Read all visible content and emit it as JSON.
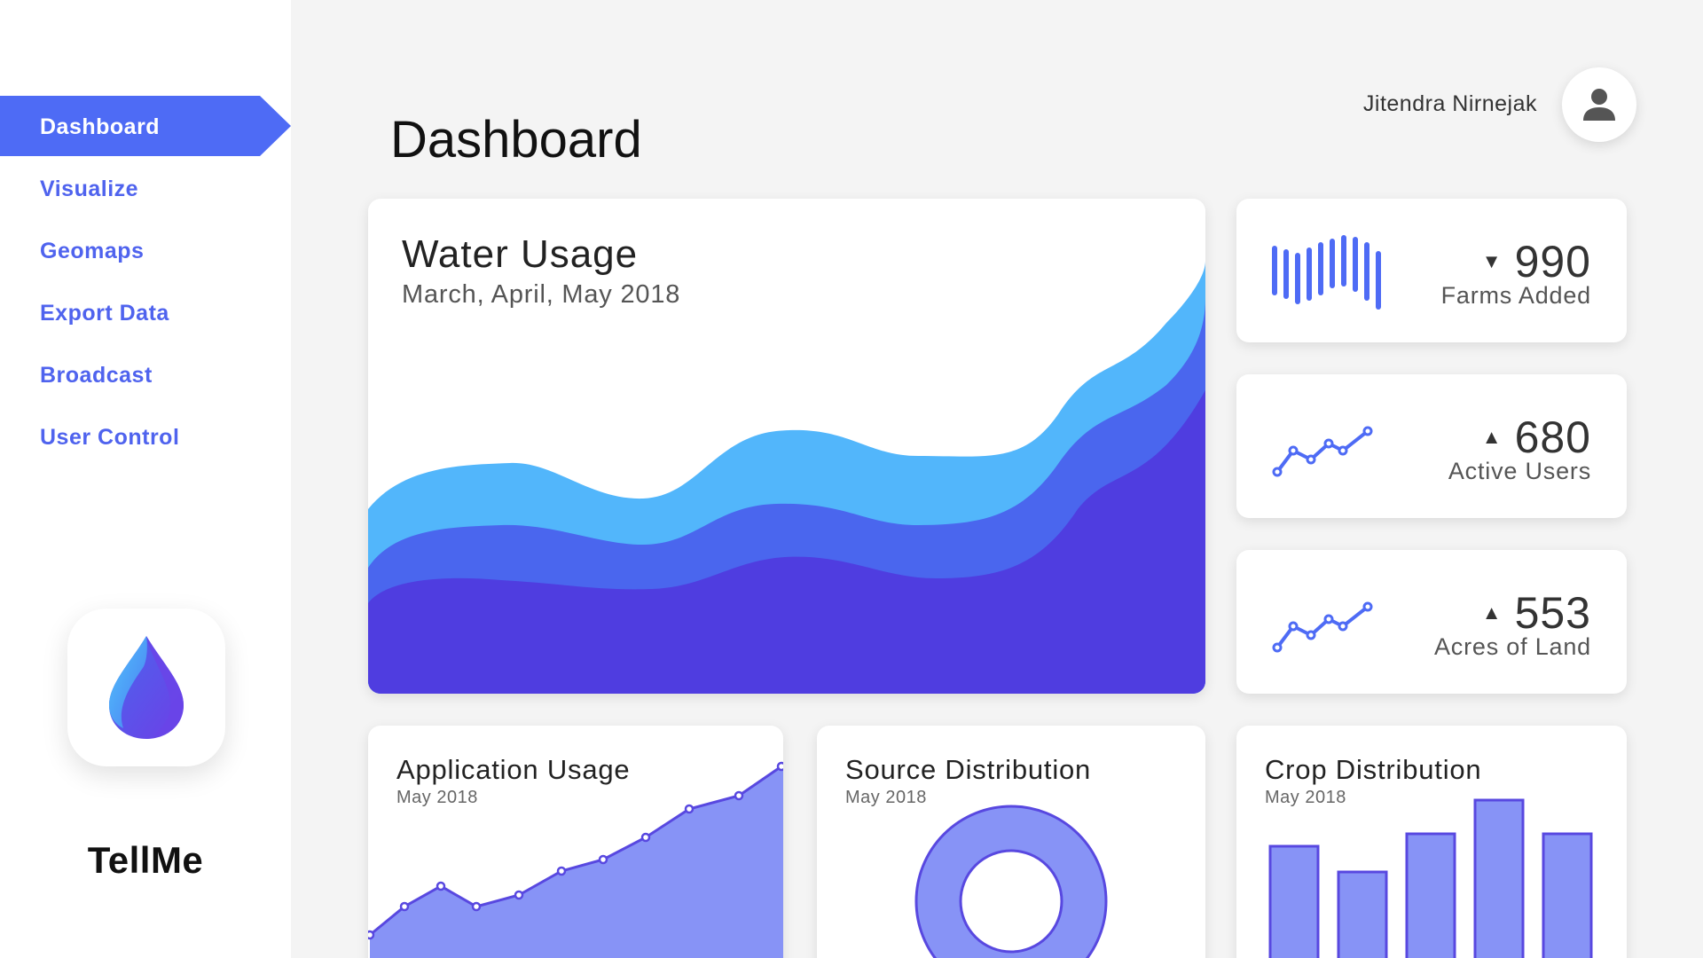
{
  "sidebar": {
    "items": [
      {
        "label": "Dashboard",
        "active": true
      },
      {
        "label": "Visualize"
      },
      {
        "label": "Geomaps"
      },
      {
        "label": "Export Data"
      },
      {
        "label": "Broadcast"
      },
      {
        "label": "User Control"
      }
    ],
    "app_name": "TellMe",
    "logo_icon": "water-drop-icon"
  },
  "header": {
    "title": "Dashboard",
    "user_name": "Jitendra Nirnejak",
    "avatar_icon": "user-icon"
  },
  "water_usage": {
    "title": "Water Usage",
    "subtitle": "March, April, May 2018"
  },
  "stats": [
    {
      "value": "990",
      "label": "Farms Added",
      "trend": "down",
      "trend_glyph": "▼",
      "icon": "bars-sparkline-icon"
    },
    {
      "value": "680",
      "label": "Active Users",
      "trend": "up",
      "trend_glyph": "▲",
      "icon": "line-sparkline-icon"
    },
    {
      "value": "553",
      "label": "Acres of Land",
      "trend": "up",
      "trend_glyph": "▲",
      "icon": "line-sparkline-icon"
    }
  ],
  "application_usage": {
    "title": "Application Usage",
    "subtitle": "May 2018"
  },
  "source_distribution": {
    "title": "Source Distribution",
    "subtitle": "May 2018"
  },
  "crop_distribution": {
    "title": "Crop Distribution",
    "subtitle": "May 2018"
  },
  "colors": {
    "accent": "#4e6bf5",
    "layer_light": "#52b6fb",
    "layer_mid": "#4a66ee",
    "layer_dark": "#4f3de0",
    "chart_fill": "#8793f6",
    "chart_stroke": "#5848e0"
  }
}
